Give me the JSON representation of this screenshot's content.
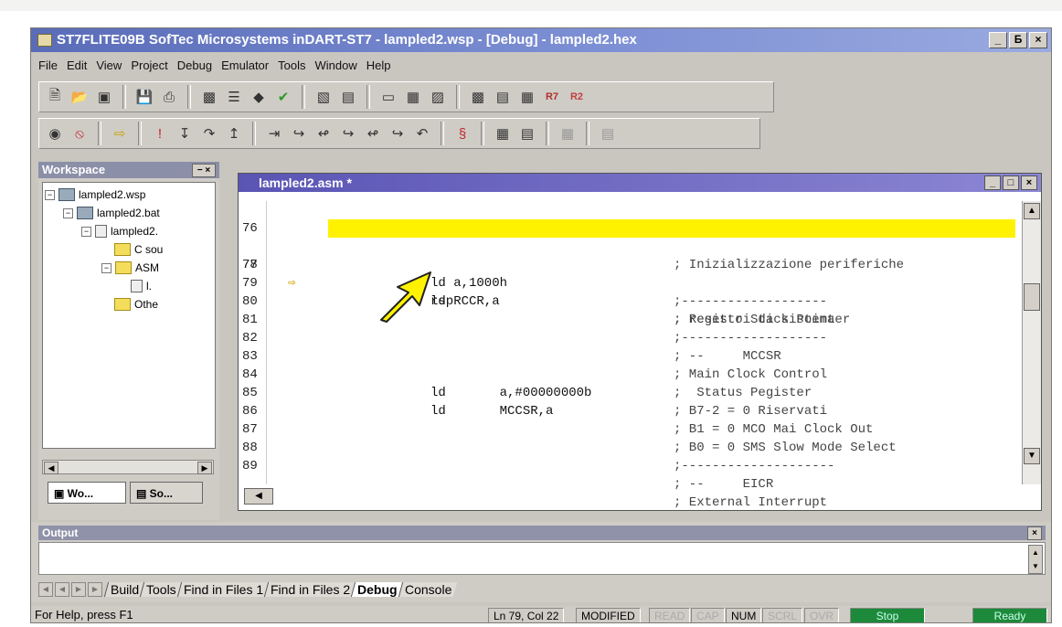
{
  "window": {
    "title": "ST7FLITE09B SofTec Microsystems  inDART-ST7 - lampled2.wsp - [Debug] - lampled2.hex",
    "controls": [
      "_",
      "Б",
      "×"
    ]
  },
  "menu": [
    {
      "label": "File"
    },
    {
      "label": "Edit"
    },
    {
      "label": "View"
    },
    {
      "label": "Project"
    },
    {
      "label": "Debug"
    },
    {
      "label": "Emulator"
    },
    {
      "label": "Tools"
    },
    {
      "label": "Window"
    },
    {
      "label": "Help"
    }
  ],
  "toolbar1": {
    "icons": [
      "new-file-icon",
      "open-folder-icon",
      "open-workspace-icon",
      "save-icon",
      "print-icon",
      "find-icon",
      "build-icon",
      "compile-icon",
      "check-icon",
      "window-icon",
      "output-icon",
      "memory-icon",
      "registers-icon",
      "watch-icon",
      "stack-icon",
      "disasm-icon",
      "io-icon"
    ],
    "r7_label": "R7",
    "r2_label": "R2"
  },
  "toolbar2": {
    "icons": [
      "reset-icon",
      "stop-icon",
      "go-icon",
      "breakpoint-icon",
      "step-icon",
      "step-over-icon",
      "step-out-icon",
      "run-to-icon",
      "trace-icon",
      "trace2-icon",
      "trace3-icon",
      "trace4-icon",
      "trace5-icon",
      "halt-icon",
      "emu-icon",
      "chip-icon",
      "chip2-icon",
      "chip3-icon"
    ]
  },
  "workspace": {
    "title": "Workspace",
    "tree": [
      {
        "label": "lampled2.wsp",
        "icon": "workspace-icon"
      },
      {
        "label": "lampled2.bat",
        "icon": "project-icon"
      },
      {
        "label": "lampled2.",
        "icon": "file-icon"
      },
      {
        "label": "C sou",
        "icon": "folder-icon"
      },
      {
        "label": "ASM",
        "icon": "folder-icon"
      },
      {
        "label": "l.",
        "icon": "file-icon"
      },
      {
        "label": "Othe",
        "icon": "folder-icon"
      }
    ],
    "tabs": [
      {
        "label": "Wo..."
      },
      {
        "label": "So..."
      }
    ]
  },
  "editor": {
    "title": "lampled2.asm *",
    "current_line_marker": "⇨",
    "lines": [
      {
        "num": "76",
        "instr": "",
        "comment": "; Inizializzazione periferiche"
      },
      {
        "num": "77",
        "instr": "rsp",
        "comment": "; resetto Stack Pointer"
      },
      {
        "num": "78",
        "instr": "ld a,1000h",
        "comment": ";-------------------"
      },
      {
        "num": "79",
        "instr": "ld RCCR,a",
        "comment": "; Registri di sistema"
      },
      {
        "num": "80",
        "instr": "",
        "comment": ";-------------------"
      },
      {
        "num": "81",
        "instr": "",
        "comment": "; --     MCCSR"
      },
      {
        "num": "82",
        "instr": "",
        "comment": "; Main Clock Control"
      },
      {
        "num": "83",
        "instr": "",
        "comment": ";  Status Pegister"
      },
      {
        "num": "84",
        "instr": "ld       a,#00000000b",
        "comment": "; B7-2 = 0 Riservati"
      },
      {
        "num": "85",
        "instr": "ld       MCCSR,a",
        "comment": "; B1 = 0 MCO Mai Clock Out"
      },
      {
        "num": "86",
        "instr": "",
        "comment": "; B0 = 0 SMS Slow Mode Select"
      },
      {
        "num": "87",
        "instr": "",
        "comment": ";--------------------"
      },
      {
        "num": "88",
        "instr": "",
        "comment": "; --     EICR"
      },
      {
        "num": "89",
        "instr": "",
        "comment": "; External Interrupt"
      }
    ],
    "highlighted_line": "77"
  },
  "output": {
    "title": "Output",
    "tabs": [
      {
        "label": "Build"
      },
      {
        "label": "Tools"
      },
      {
        "label": "Find in Files 1"
      },
      {
        "label": "Find in Files 2"
      },
      {
        "label": "Debug",
        "active": true
      },
      {
        "label": "Console"
      }
    ]
  },
  "status": {
    "help": "For Help, press F1",
    "position": "Ln 79, Col 22",
    "modified": "MODIFIED",
    "read": "READ",
    "cap": "CAP",
    "num": "NUM",
    "scrl": "SCRL",
    "ovr": "OVR",
    "stop": "Stop",
    "ready": "Ready"
  },
  "colors": {
    "highlight": "#fff200",
    "title_gradient": "#5a6cb8",
    "arrow": "#fff200",
    "status_green": "#1c8a3a"
  }
}
